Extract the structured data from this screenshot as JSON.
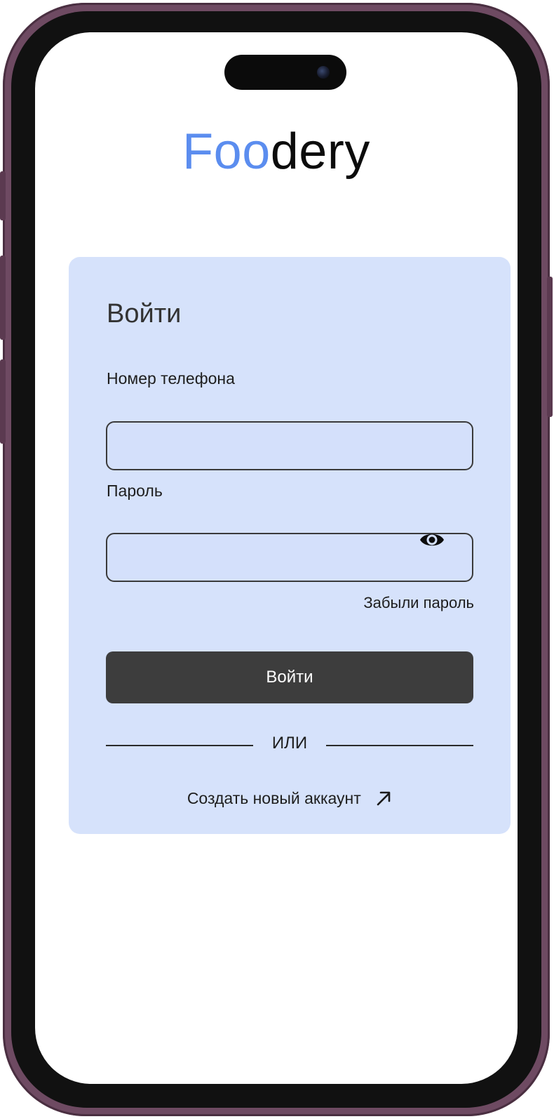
{
  "app": {
    "logo_accent": "Foo",
    "logo_rest": "dery",
    "accent_color": "#5b8def"
  },
  "login_card": {
    "title": "Войти",
    "phone_label": "Номер телефона",
    "phone_value": "",
    "password_label": "Пароль",
    "password_value": "",
    "password_toggle_icon": "eye-icon",
    "forgot_password": "Забыли пароль",
    "submit_label": "Войти",
    "divider_text": "ИЛИ",
    "create_account": "Создать новый аккаунт",
    "create_account_icon": "arrow-up-right-icon",
    "card_color": "#d6e2fb",
    "button_color": "#3d3d3d"
  }
}
